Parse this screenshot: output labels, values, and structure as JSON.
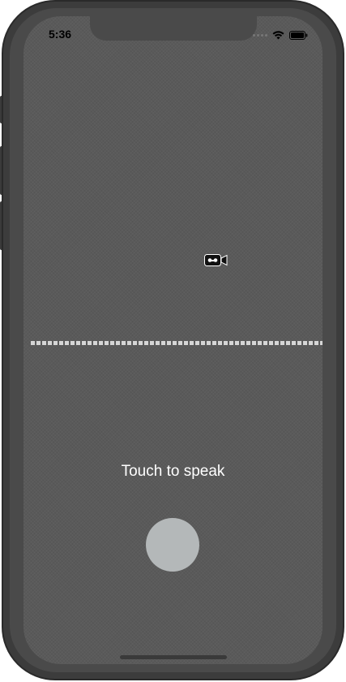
{
  "status_bar": {
    "time": "5:36",
    "signal_icon": "signal-dots-icon",
    "wifi_icon": "wifi-icon",
    "battery_icon": "battery-icon"
  },
  "main": {
    "camera_icon": "video-camera-icon",
    "waveform": "waveform-line",
    "touch_label": "Touch to speak",
    "speak_button_icon": "record-button"
  },
  "colors": {
    "background": "#5a5a5a",
    "frame": "#3c3c3c",
    "label": "#ffffff",
    "button": "#b4b8b9",
    "waveform": "#d6d6d6"
  }
}
